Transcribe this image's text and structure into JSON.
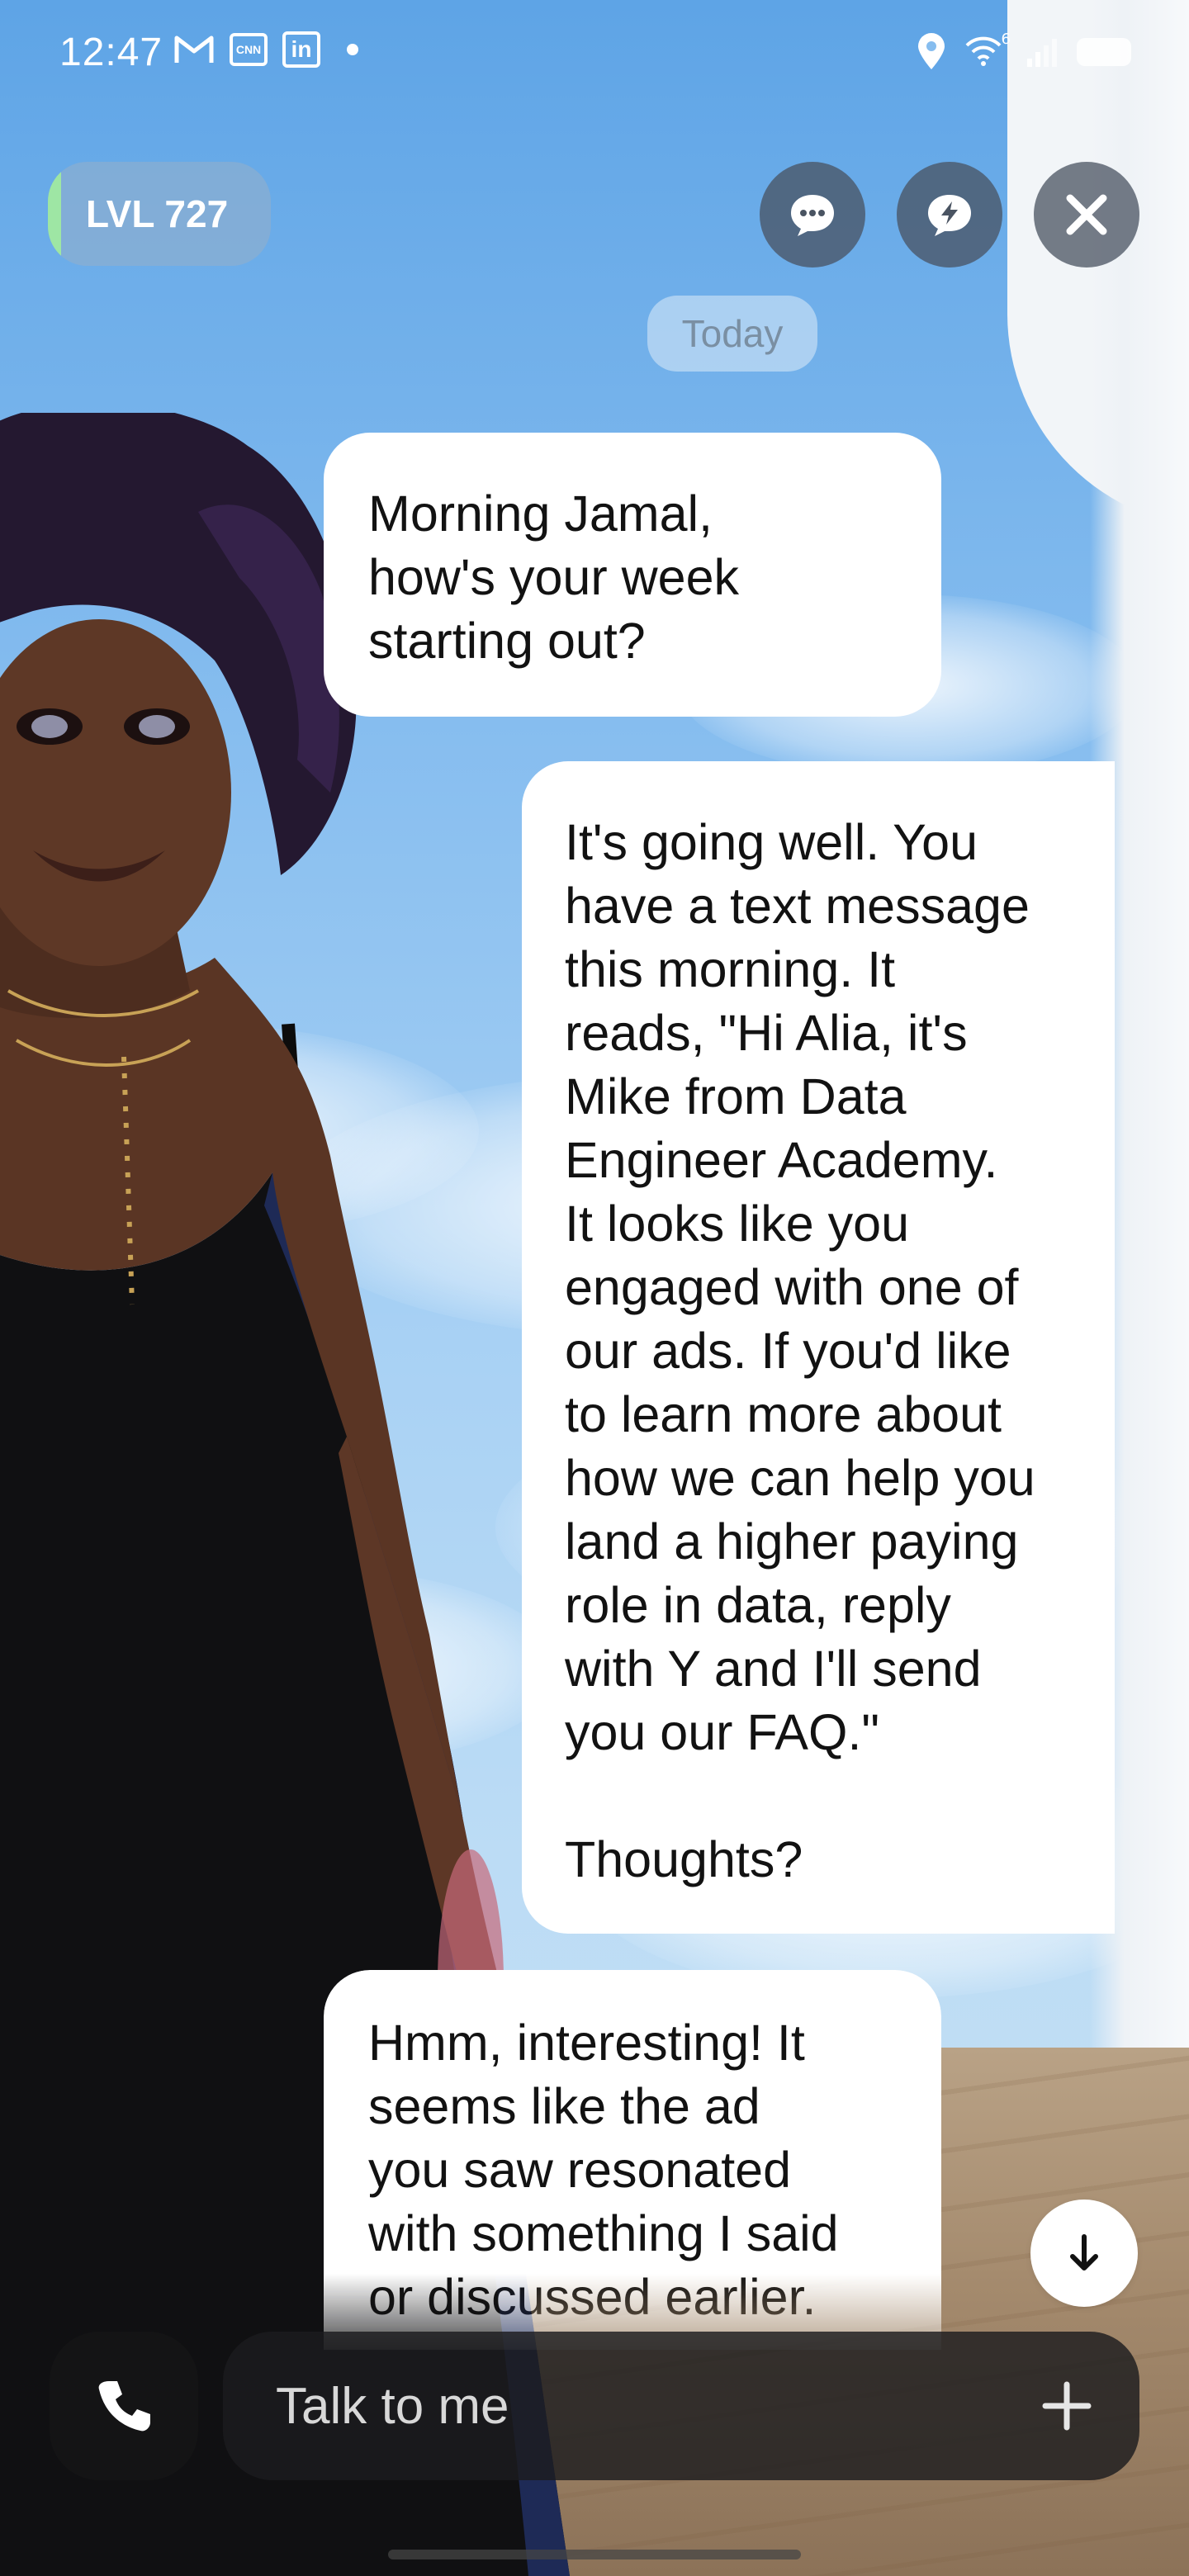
{
  "status_bar": {
    "time": "12:47",
    "left_icons": [
      "gmail-icon",
      "cnn-icon",
      "linkedin-icon",
      "dot-icon"
    ],
    "right_icons": [
      "location-icon",
      "wifi-icon",
      "signal-icon",
      "battery-icon"
    ],
    "wifi_label": "6"
  },
  "header": {
    "level_label": "LVL 727",
    "level_progress_fraction": 0.06,
    "buttons": [
      "chat-bubble-icon",
      "lightning-bubble-icon",
      "close-icon"
    ]
  },
  "chat": {
    "date_label": "Today",
    "messages": [
      {
        "sender": "avatar",
        "text": "Morning Jamal,\nhow's your week\nstarting out?"
      },
      {
        "sender": "user",
        "text": "It's going well. You\nhave a text message\nthis morning. It\nreads, \"Hi Alia, it's\nMike from Data\nEngineer Academy.\nIt looks like you\nengaged with one of\nour ads. If you'd like\nto learn more about\nhow we can help you\nland a higher paying\nrole in data, reply\nwith Y and I'll send\nyou our FAQ.\"\n\nThoughts?"
      },
      {
        "sender": "avatar",
        "text": "Hmm, interesting! It\nseems like the ad\nyou saw resonated\nwith something I said\nor discussed earlier."
      }
    ]
  },
  "composer": {
    "placeholder": "Talk to me",
    "call_icon": "phone-icon",
    "add_icon": "plus-icon",
    "scroll_icon": "arrow-down-icon"
  },
  "colors": {
    "sky_top": "#5ea4e6",
    "bubble_bg": "#ffffff",
    "level_accent": "#9ee6a4",
    "dark_control": "#1c1c1e"
  }
}
